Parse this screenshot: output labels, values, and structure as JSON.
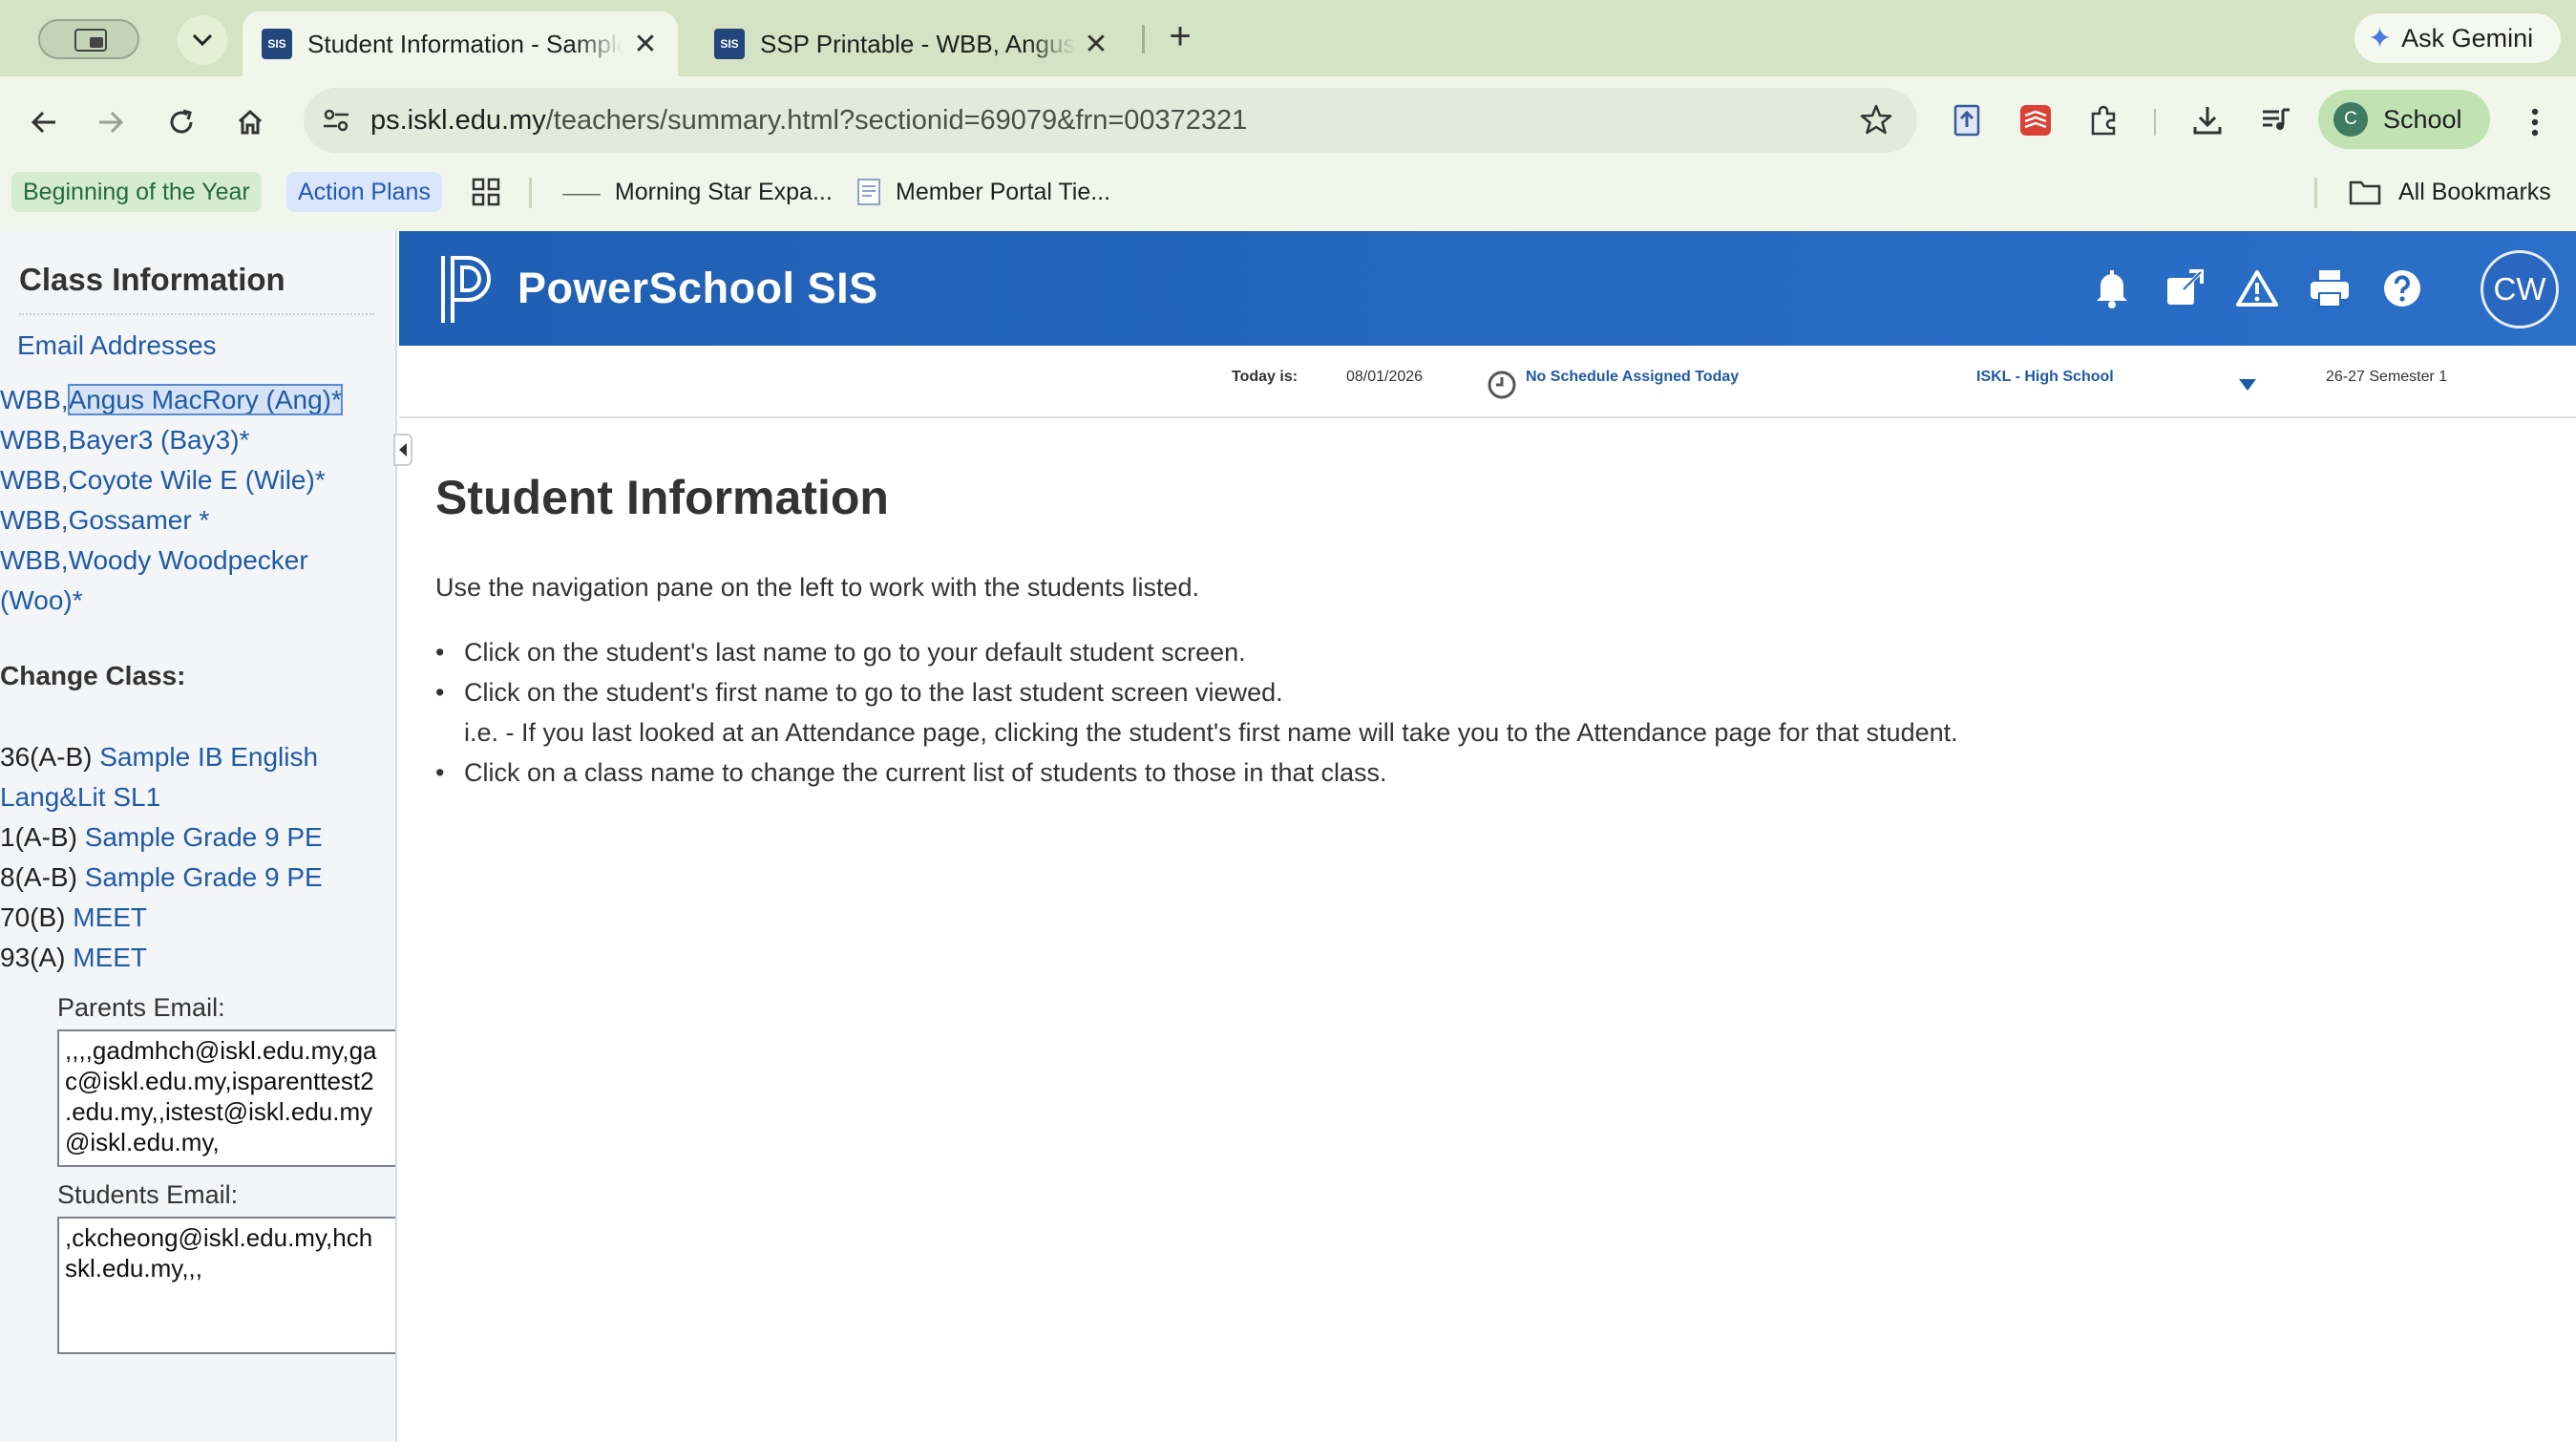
{
  "browser": {
    "tabs": [
      {
        "favicon": "SIS",
        "title": "Student Information - Sample IB English",
        "active": true
      },
      {
        "favicon": "SIS",
        "title": "SSP Printable - WBB, Angus MacRory",
        "active": false
      }
    ],
    "ask_gemini": "Ask Gemini",
    "url_host": "ps.iskl.edu.my",
    "url_path": "/teachers/summary.html?sectionid=69079&frn=00372321",
    "profile_initial": "C",
    "profile_label": "School",
    "bookmarks": [
      {
        "label": "Beginning of the Year"
      },
      {
        "label": "Action Plans"
      },
      {
        "label": "Morning Star Expa..."
      },
      {
        "label": "Member Portal Tie..."
      }
    ],
    "all_bookmarks": "All Bookmarks"
  },
  "sidebar": {
    "title": "Class Information",
    "email_link": "Email Addresses",
    "students": [
      {
        "prefix": "WBB,",
        "name": "Angus MacRory (Ang)*",
        "selected": true
      },
      {
        "prefix": "WBB,",
        "name": "Bayer3 (Bay3)*",
        "selected": false
      },
      {
        "prefix": "WBB,",
        "name": "Coyote Wile E (Wile)*",
        "selected": false
      },
      {
        "prefix": "WBB,",
        "name": "Gossamer *",
        "selected": false
      },
      {
        "prefix": "WBB,",
        "name": "Woody Woodpecker (Woo)*",
        "selected": false
      }
    ],
    "change_class_label": "Change Class:",
    "classes": [
      {
        "period": "36(A-B)",
        "name": "Sample IB English Lang&Lit SL1"
      },
      {
        "period": "1(A-B)",
        "name": "Sample Grade 9 PE"
      },
      {
        "period": "8(A-B)",
        "name": "Sample Grade 9 PE"
      },
      {
        "period": "70(B)",
        "name": "MEET"
      },
      {
        "period": "93(A)",
        "name": "MEET"
      }
    ],
    "parents_email_label": "Parents Email:",
    "parents_email_value": ",,,,gadmhch@iskl.edu.my,ga\nc@iskl.edu.my,isparenttest2\n.edu.my,,istest@iskl.edu.my\n@iskl.edu.my,",
    "students_email_label": "Students Email:",
    "students_email_value": ",ckcheong@iskl.edu.my,hch\nskl.edu.my,,,"
  },
  "header": {
    "app_title": "PowerSchool SIS",
    "user_initials": "CW"
  },
  "status": {
    "today_label": "Today is:",
    "today_value": "08/01/2026",
    "schedule": "No Schedule Assigned Today",
    "school": "ISKL - High School",
    "term": "26-27 Semester 1"
  },
  "main": {
    "title": "Student Information",
    "intro": "Use the navigation pane on the left to work with the students listed.",
    "bullets": [
      {
        "text": "Click on the student's last name to go to your default student screen.",
        "sub": ""
      },
      {
        "text": "Click on the student's first name to go to the last student screen viewed.",
        "sub": "i.e. - If you last looked at an Attendance page, clicking the student's first name will take you to the Attendance page for that student."
      },
      {
        "text": "Click on a class name to change the current list of students to those in that class.",
        "sub": ""
      }
    ]
  },
  "colors": {
    "header_blue": "#2668c0",
    "link_blue": "#1f5aa6",
    "chrome_green": "#d3e3c4"
  }
}
